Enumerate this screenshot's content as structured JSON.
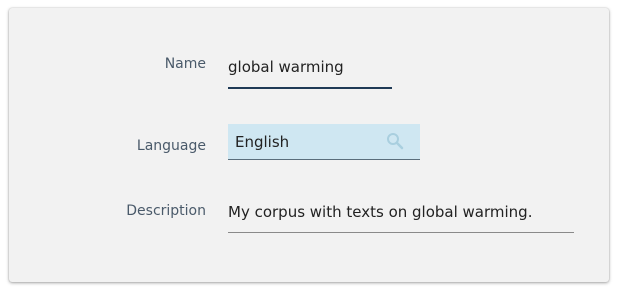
{
  "form": {
    "name": {
      "label": "Name",
      "value": "global warming"
    },
    "language": {
      "label": "Language",
      "value": "English",
      "icon": "search-icon"
    },
    "description": {
      "label": "Description",
      "value": "My corpus with texts on global warming."
    }
  },
  "colors": {
    "card_background": "#f2f2f2",
    "label_text": "#4a5a6a",
    "active_underline": "#1f3a56",
    "select_background": "#cfe7f2",
    "inactive_underline": "#8a8a8a"
  }
}
